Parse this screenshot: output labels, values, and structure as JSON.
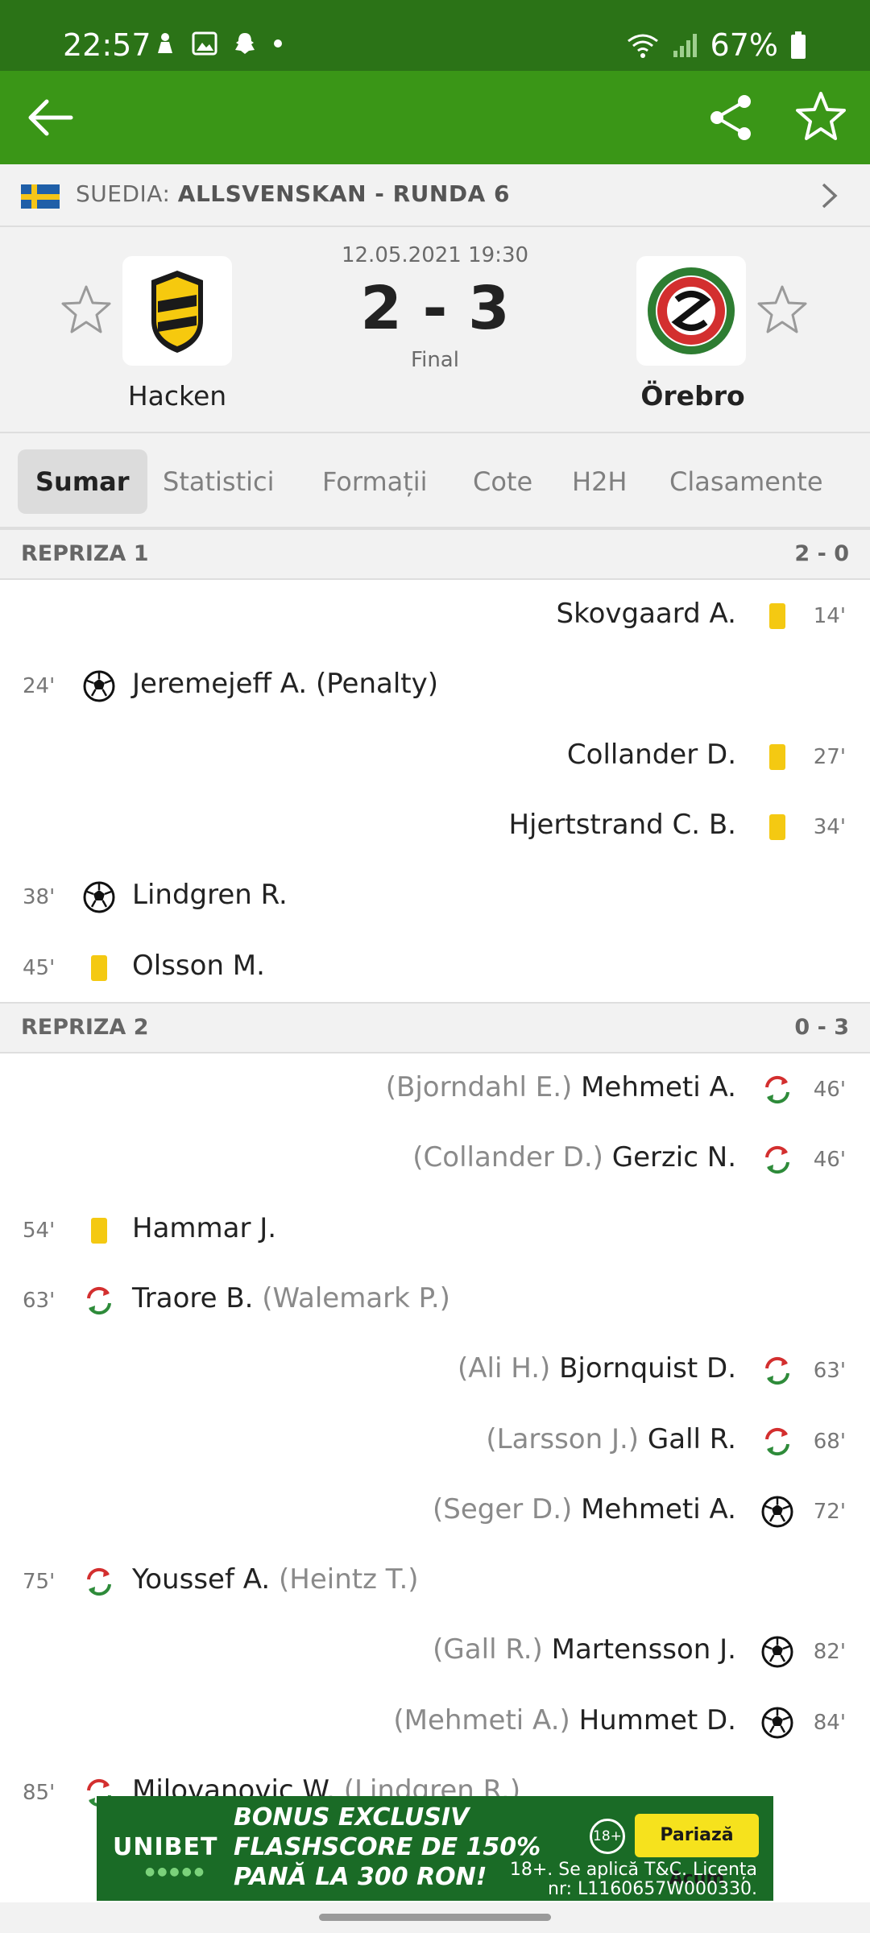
{
  "status_bar": {
    "time": "22:57",
    "battery": "67%",
    "left_icons": [
      "notification-icon",
      "gallery-icon",
      "snapchat-icon",
      "dot-icon"
    ],
    "right_icons": [
      "wifi-icon",
      "signal-icon",
      "battery-icon"
    ]
  },
  "app_bar": {
    "back_icon": "arrow-left-icon",
    "share_icon": "share-icon",
    "favorite_icon": "star-icon",
    "background": "#3a9617"
  },
  "league": {
    "country": "SUEDIA:",
    "competition": "ALLSVENSKAN - RUNDA 6"
  },
  "match": {
    "datetime": "12.05.2021 19:30",
    "score": "2 - 3",
    "status": "Final",
    "home_team": "Hacken",
    "away_team": "Örebro"
  },
  "tabs": [
    "Sumar",
    "Statistici",
    "Formații",
    "Cote",
    "H2H",
    "Clasamente"
  ],
  "active_tab": "Sumar",
  "periods": [
    {
      "title": "REPRIZA 1",
      "score": "2 - 0",
      "incidents": [
        {
          "side": "away",
          "minute": "14'",
          "type": "yellow-card",
          "player": "Skovgaard A.",
          "sub": ""
        },
        {
          "side": "home",
          "minute": "24'",
          "type": "goal",
          "player": "Jeremejeff A. (Penalty)",
          "sub": ""
        },
        {
          "side": "away",
          "minute": "27'",
          "type": "yellow-card",
          "player": "Collander D.",
          "sub": ""
        },
        {
          "side": "away",
          "minute": "34'",
          "type": "yellow-card",
          "player": "Hjertstrand C. B.",
          "sub": ""
        },
        {
          "side": "home",
          "minute": "38'",
          "type": "goal",
          "player": "Lindgren R.",
          "sub": ""
        },
        {
          "side": "home",
          "minute": "45'",
          "type": "yellow-card",
          "player": "Olsson M.",
          "sub": ""
        }
      ]
    },
    {
      "title": "REPRIZA 2",
      "score": "0 - 3",
      "incidents": [
        {
          "side": "away",
          "minute": "46'",
          "type": "substitution",
          "player": "Mehmeti A.",
          "sub": "(Bjorndahl E.)"
        },
        {
          "side": "away",
          "minute": "46'",
          "type": "substitution",
          "player": "Gerzic N.",
          "sub": "(Collander D.)"
        },
        {
          "side": "home",
          "minute": "54'",
          "type": "yellow-card",
          "player": "Hammar J.",
          "sub": ""
        },
        {
          "side": "home",
          "minute": "63'",
          "type": "substitution",
          "player": "Traore B.",
          "sub": "(Walemark P.)"
        },
        {
          "side": "away",
          "minute": "63'",
          "type": "substitution",
          "player": "Bjornquist D.",
          "sub": "(Ali H.)"
        },
        {
          "side": "away",
          "minute": "68'",
          "type": "substitution",
          "player": "Gall R.",
          "sub": "(Larsson J.)"
        },
        {
          "side": "away",
          "minute": "72'",
          "type": "goal",
          "player": "Mehmeti A.",
          "sub": "(Seger D.)"
        },
        {
          "side": "home",
          "minute": "75'",
          "type": "substitution",
          "player": "Youssef A.",
          "sub": "(Heintz T.)"
        },
        {
          "side": "away",
          "minute": "82'",
          "type": "goal",
          "player": "Martensson J.",
          "sub": "(Gall R.)"
        },
        {
          "side": "away",
          "minute": "84'",
          "type": "goal",
          "player": "Hummet D.",
          "sub": "(Mehmeti A.)"
        },
        {
          "side": "home",
          "minute": "85'",
          "type": "substitution",
          "player": "Milovanovic W.",
          "sub": "(Lindgren R.)"
        }
      ]
    }
  ],
  "ad": {
    "brand": "UNIBET",
    "headline_line1": "BONUS EXCLUSIV",
    "headline_line2": "FLASHSCORE DE 150%",
    "headline_line3": "PANĂ LA 300 RON!",
    "age": "18+",
    "cta": "Pariază Acum",
    "legal_line1": "18+. Se aplică T&C. Licența",
    "legal_line2": "nr: L1160657W000330."
  }
}
